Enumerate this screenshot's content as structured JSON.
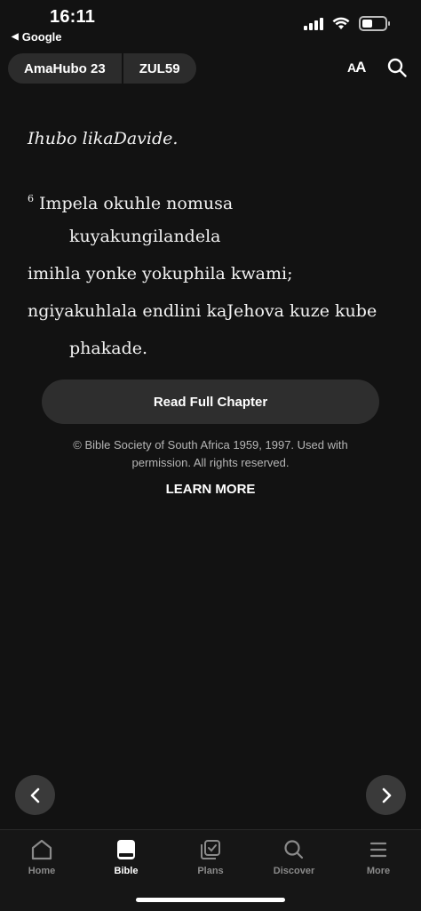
{
  "status_bar": {
    "time": "16:11",
    "back_app": "Google",
    "back_glyph": "◀"
  },
  "header": {
    "book_chapter": "AmaHubo 23",
    "version": "ZUL59",
    "font_size_big": "A",
    "font_size_small": "A"
  },
  "content": {
    "heading": "Ihubo likaDavide.",
    "verse_number": "6",
    "verse_lines": [
      "Impela okuhle nomusa",
      "kuyakungilandela",
      "imihla yonke yokuphila kwami;",
      "ngiyakuhlala endlini kaJehova kuze kube",
      "phakade."
    ],
    "read_full_chapter": "Read Full Chapter",
    "copyright": "© Bible Society of South Africa 1959, 1997. Used with permission. All rights reserved.",
    "learn_more": "LEARN MORE"
  },
  "tabs": [
    {
      "label": "Home",
      "icon": "home-icon",
      "active": false
    },
    {
      "label": "Bible",
      "icon": "bible-icon",
      "active": true
    },
    {
      "label": "Plans",
      "icon": "plans-icon",
      "active": false
    },
    {
      "label": "Discover",
      "icon": "discover-icon",
      "active": false
    },
    {
      "label": "More",
      "icon": "more-icon",
      "active": false
    }
  ],
  "colors": {
    "background": "#121212",
    "pill": "#2c2c2c",
    "button": "#2e2e2e",
    "inactive_tab": "#8a8a8a",
    "active_tab": "#ffffff"
  }
}
